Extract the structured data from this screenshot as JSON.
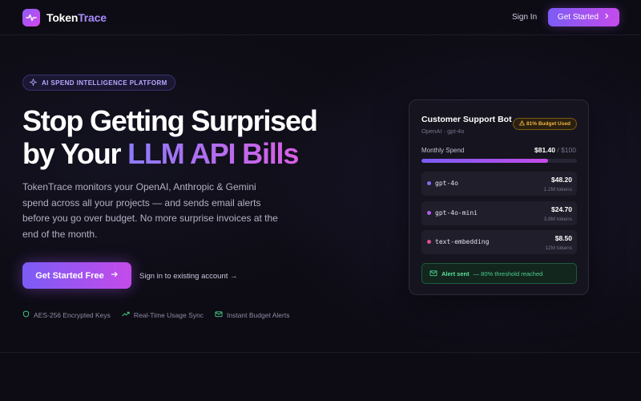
{
  "nav": {
    "brand_a": "Token",
    "brand_b": "Trace",
    "sign_in": "Sign In",
    "get_started": "Get Started"
  },
  "hero": {
    "badge": "AI SPEND INTELLIGENCE PLATFORM",
    "headline_line1": "Stop Getting Surprised",
    "headline_line2_prefix": "by Your ",
    "headline_line2_highlight": "LLM API Bills",
    "description": "TokenTrace monitors your OpenAI, Anthropic & Gemini spend across all your projects — and sends email alerts before you go over budget. No more surprise invoices at the end of the month.",
    "cta_primary": "Get Started Free",
    "cta_secondary": "Sign in to existing account →",
    "features": [
      "AES-256 Encrypted Keys",
      "Real-Time Usage Sync",
      "Instant Budget Alerts"
    ]
  },
  "card": {
    "title": "Customer Support Bot",
    "subtitle": "OpenAI · gpt-4o",
    "budget_badge": "81% Budget Used",
    "monthly_label": "Monthly Spend",
    "monthly_value": "$81.40",
    "monthly_limit": "/ $100",
    "budget_fraction": 0.814,
    "models": [
      {
        "name": "gpt-4o",
        "cost": "$48.20",
        "tokens": "1.2M tokens",
        "color": "#7c6cf5"
      },
      {
        "name": "gpt-4o-mini",
        "cost": "$24.70",
        "tokens": "3.8M tokens",
        "color": "#b45cf0"
      },
      {
        "name": "text-embedding",
        "cost": "$8.50",
        "tokens": "12M tokens",
        "color": "#e0508f"
      }
    ],
    "alert_title": "Alert sent",
    "alert_text": "— 80% threshold reached"
  },
  "colors": {
    "accent_start": "#7b5cf5",
    "accent_end": "#c44bea",
    "success": "#4ad08a",
    "warning": "#f2b43c"
  }
}
